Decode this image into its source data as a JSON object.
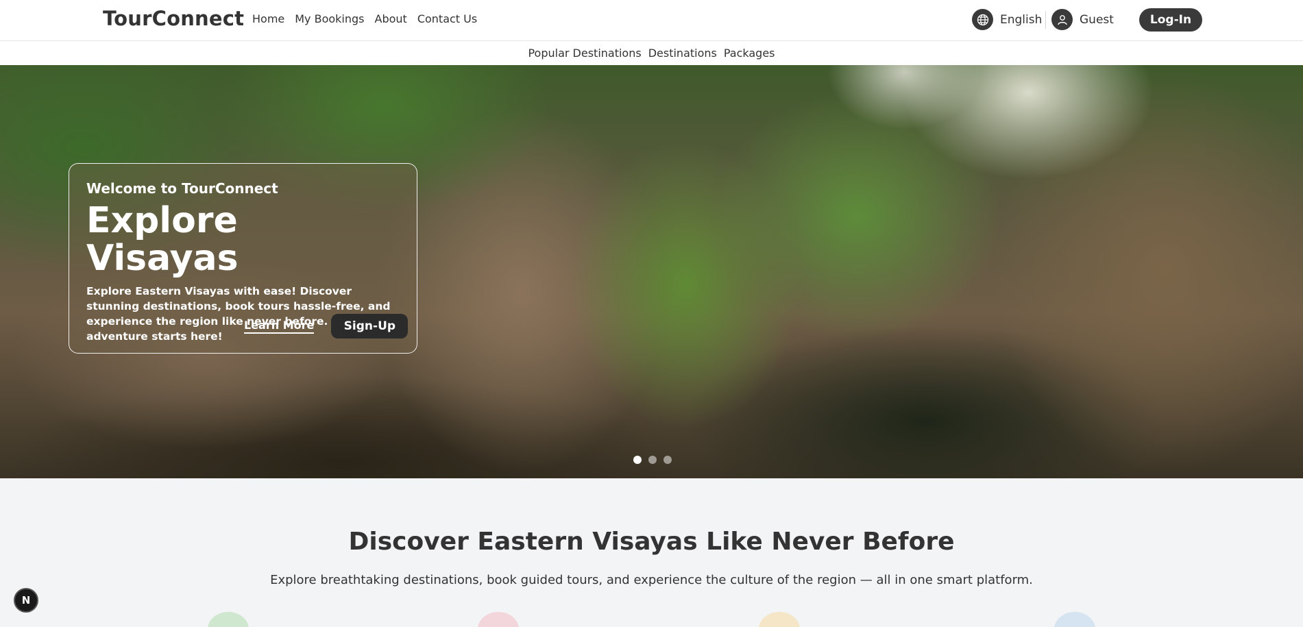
{
  "header": {
    "brand": "TourConnect",
    "nav": [
      "Home",
      "My Bookings",
      "About",
      "Contact Us"
    ],
    "language_label": "English",
    "user_label": "Guest",
    "login_label": "Log-In"
  },
  "subnav": [
    "Popular Destinations",
    "Destinations",
    "Packages"
  ],
  "hero": {
    "welcome": "Welcome to TourConnect",
    "title": "Explore Visayas",
    "description": "Explore Eastern Visayas with ease! Discover stunning destinations, book tours hassle-free, and experience the region like never before. Your next adventure starts here!",
    "learn_more_label": "Learn More",
    "signup_label": "Sign-Up",
    "slides_count": 3,
    "active_slide": 1
  },
  "discover": {
    "title": "Discover Eastern Visayas Like Never Before",
    "subtitle": "Explore breathtaking destinations, book guided tours, and experience the culture of the region — all in one smart platform.",
    "feature_colors": [
      "#cfe6cf",
      "#f3d6dc",
      "#f4e6c6",
      "#d6e4f2"
    ]
  },
  "dev_badge": "N",
  "colors": {
    "dark_button": "#3a3a3a",
    "text": "#333333",
    "section_bg": "#f3f4f6"
  }
}
